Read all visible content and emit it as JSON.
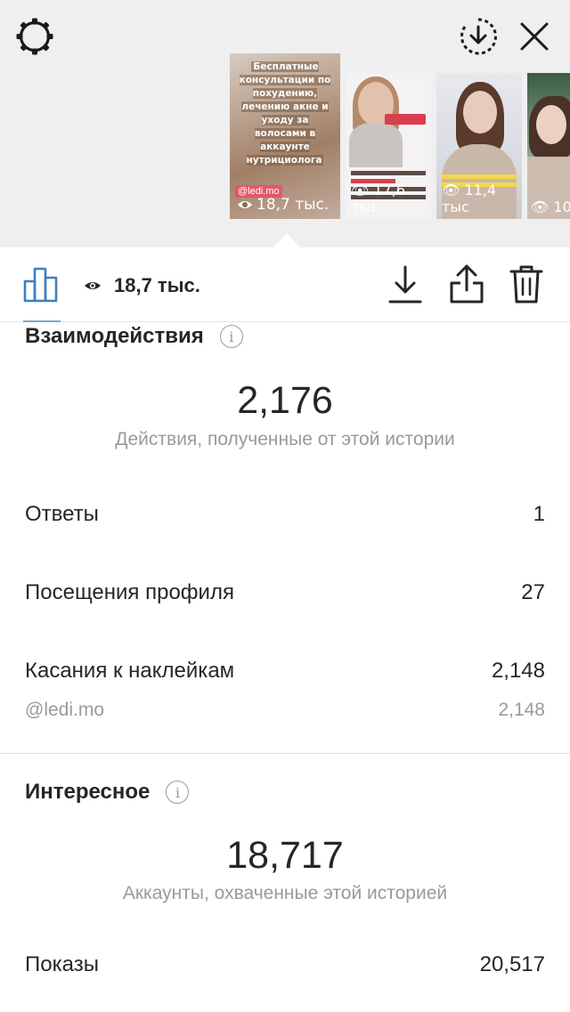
{
  "header": {
    "icons": {
      "settings": "settings-icon",
      "download_circle": "download-circle-icon",
      "close": "close-icon"
    }
  },
  "story_strip": [
    {
      "caption": "Бесплатные консультации по похудению, лечению акне и уходу за волосами в аккаунте нутрициолога",
      "handle": "@ledi.mo",
      "views": "18,7 тыс.",
      "selected": true
    },
    {
      "views": "17,6 тыс"
    },
    {
      "views": "11,4 тыс"
    },
    {
      "views": "10"
    }
  ],
  "toolbar": {
    "views": "18,7 тыс.",
    "icons": [
      "insights-chart-icon",
      "eye-icon",
      "download-icon",
      "share-icon",
      "trash-icon"
    ]
  },
  "interactions": {
    "title": "Взаимодействия",
    "total": "2,176",
    "total_caption": "Действия, полученные от этой истории",
    "rows": [
      {
        "label": "Ответы",
        "value": "1"
      },
      {
        "label": "Посещения профиля",
        "value": "27"
      },
      {
        "label": "Касания к наклейкам",
        "value": "2,148"
      }
    ],
    "sticker_detail": {
      "label": "@ledi.mo",
      "value": "2,148"
    }
  },
  "discovery": {
    "title": "Интересное",
    "total": "18,717",
    "total_caption": "Аккаунты, охваченные этой историей",
    "rows": [
      {
        "label": "Показы",
        "value": "20,517"
      }
    ]
  },
  "colors": {
    "header_bg": "#efefef",
    "accent_blue": "#3d7fbf",
    "text_primary": "#262626",
    "text_secondary": "#9a9a9a"
  }
}
